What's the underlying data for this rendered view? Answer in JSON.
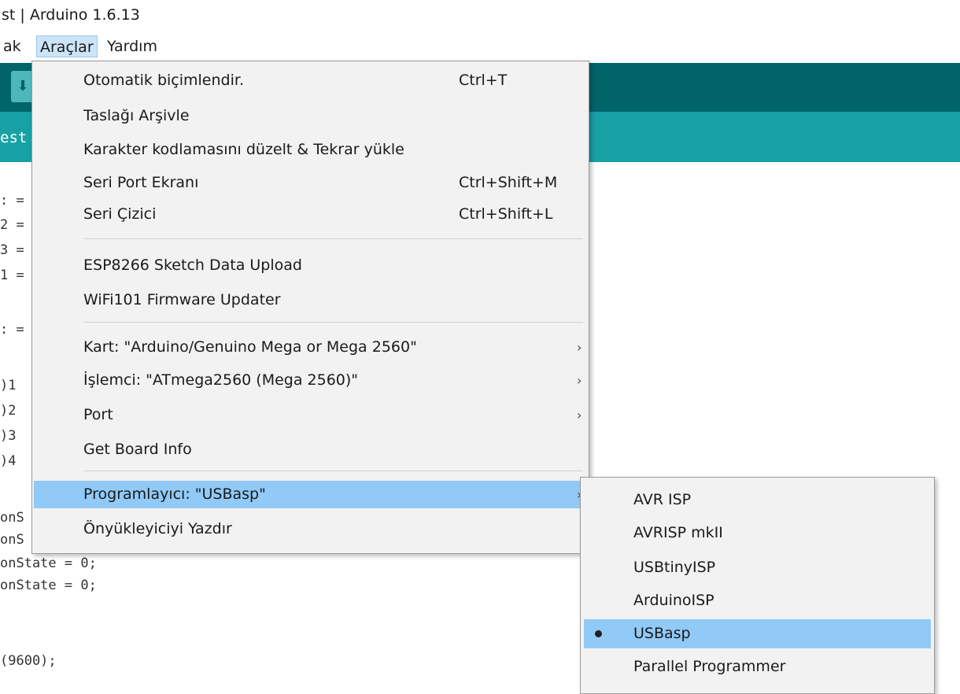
{
  "window": {
    "title": "st | Arduino 1.6.13"
  },
  "menubar": {
    "items": [
      "ak",
      "Araçlar",
      "Yardım"
    ]
  },
  "sketch": {
    "tab_label": "est"
  },
  "code_lines": [
    ": =",
    "2 =",
    "3 =",
    "1 =",
    "",
    ": =",
    "",
    ")1",
    ")2",
    ")3",
    ")4",
    "",
    "onS",
    "onS",
    "onState = 0;",
    "onState = 0;",
    "",
    "",
    "(9600);"
  ],
  "menu": {
    "items": [
      {
        "label": "Otomatik biçimlendir.",
        "shortcut": "Ctrl+T"
      },
      {
        "label": "Taslağı Arşivle",
        "shortcut": ""
      },
      {
        "label": "Karakter kodlamasını düzelt & Tekrar yükle",
        "shortcut": ""
      },
      {
        "label": "Seri Port Ekranı",
        "shortcut": "Ctrl+Shift+M"
      },
      {
        "label": "Seri Çizici",
        "shortcut": "Ctrl+Shift+L"
      },
      {
        "label": "ESP8266 Sketch Data Upload",
        "shortcut": ""
      },
      {
        "label": "WiFi101 Firmware Updater",
        "shortcut": ""
      },
      {
        "label": "Kart: \"Arduino/Genuino Mega or Mega 2560\"",
        "shortcut": ""
      },
      {
        "label": "İşlemci: \"ATmega2560 (Mega 2560)\"",
        "shortcut": ""
      },
      {
        "label": "Port",
        "shortcut": ""
      },
      {
        "label": "Get Board Info",
        "shortcut": ""
      },
      {
        "label": "Programlayıcı: \"USBasp\"",
        "shortcut": ""
      },
      {
        "label": "Önyükleyiciyi Yazdır",
        "shortcut": ""
      }
    ]
  },
  "submenu": {
    "selected": "USBasp",
    "items": [
      "AVR ISP",
      "AVRISP mkII",
      "USBtinyISP",
      "ArduinoISP",
      "USBasp",
      "Parallel Programmer"
    ]
  },
  "colors": {
    "toolbar": "#006468",
    "tabbar": "#17a1a5",
    "highlight": "#91c9f7"
  }
}
